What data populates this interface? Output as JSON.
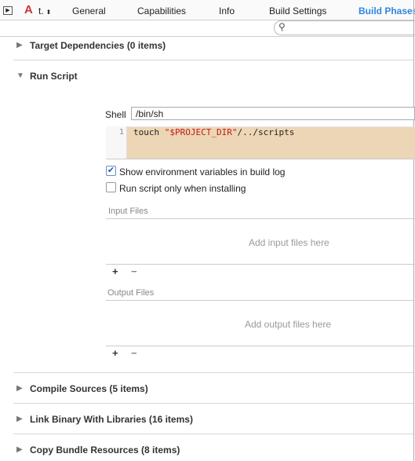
{
  "toolbar": {
    "target": "t.",
    "tabs": [
      "General",
      "Capabilities",
      "Info",
      "Build Settings",
      "Build Phases"
    ],
    "active_tab": "Build Phases",
    "search_placeholder": ""
  },
  "phases": {
    "target_dependencies": "Target Dependencies (0 items)",
    "run_script": {
      "title": "Run Script",
      "shell_label": "Shell",
      "shell_value": "/bin/sh",
      "line_number": "1",
      "code_prefix": "touch ",
      "code_string": "\"$PROJECT_DIR\"",
      "code_suffix": "/../scripts",
      "show_env_label": "Show environment variables in build log",
      "show_env_checked": true,
      "install_only_label": "Run script only when installing",
      "install_only_checked": false,
      "input_files_label": "Input Files",
      "input_placeholder": "Add input files here",
      "output_files_label": "Output Files",
      "output_placeholder": "Add output files here",
      "add": "+",
      "remove": "−"
    },
    "compile_sources": "Compile Sources (5 items)",
    "link_binary": "Link Binary With Libraries (16 items)",
    "copy_bundle": "Copy Bundle Resources (8 items)"
  },
  "colors": {
    "accent": "#2f86e0",
    "code_bg": "#ecd6b6",
    "string": "#c41a16"
  }
}
